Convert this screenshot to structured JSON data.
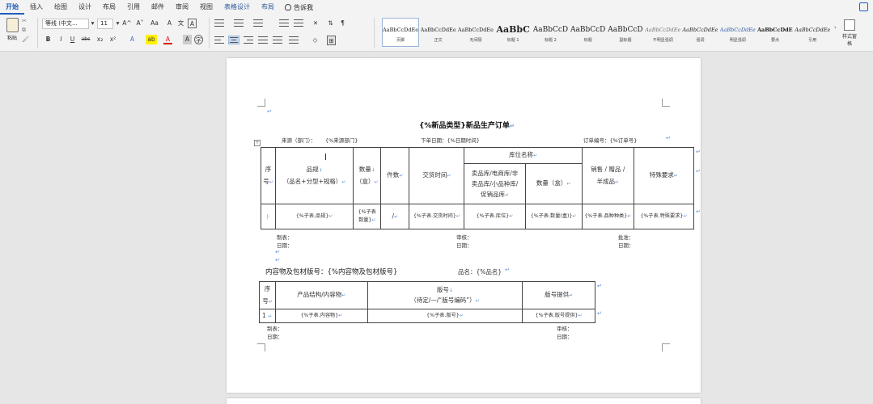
{
  "tabs": [
    "开始",
    "插入",
    "绘图",
    "设计",
    "布局",
    "引用",
    "邮件",
    "审阅",
    "视图",
    "表格设计",
    "布局"
  ],
  "tell_me": "告诉我",
  "ribbon": {
    "paste": "粘贴",
    "font_name": "等线 (中文...",
    "font_size": "11",
    "grow": "A^",
    "shrink": "A˅",
    "case": "Aa",
    "clear": "A",
    "wen": "文",
    "box": "A",
    "bold": "B",
    "italic": "I",
    "underline": "U",
    "strike": "abc",
    "sub": "x₂",
    "sup": "x²",
    "effect": "A",
    "highlight": "ab",
    "color": "A",
    "shade": "A",
    "circle": "字"
  },
  "styles": [
    {
      "sample": "AaBbCcDdEe",
      "name": "页脚",
      "selected": true
    },
    {
      "sample": "AaBbCcDdEe",
      "name": "正文"
    },
    {
      "sample": "AaBbCcDdEe",
      "name": "无间隔"
    },
    {
      "sample": "AaBbC",
      "name": "标题 1",
      "big": true
    },
    {
      "sample": "AaBbCcD",
      "name": "标题 2"
    },
    {
      "sample": "AaBbCcD",
      "name": "标题"
    },
    {
      "sample": "AaBbCcD",
      "name": "副标题"
    },
    {
      "sample": "AaBbCcDdEe",
      "name": "不明显强调"
    },
    {
      "sample": "AaBbCcDdEe",
      "name": "强调"
    },
    {
      "sample": "AaBbCcDdEe",
      "name": "明显强调"
    },
    {
      "sample": "AaBbCcDdEe",
      "name": "要点"
    },
    {
      "sample": "AaBbCcDdEe",
      "name": "引用"
    }
  ],
  "styles_pane": "样式窗格",
  "document": {
    "title": "{%新品类型}新品生产订单",
    "source_label": "来源（部门）：",
    "source_value": "{%来源部门}",
    "date_label": "下单日期：{%日期时间}",
    "order_label": "订单编号：{%订单号}",
    "table1": {
      "h_seq": [
        "序",
        "号"
      ],
      "h_product": [
        "品规",
        "（品名+分型+规格）"
      ],
      "h_qty": [
        "数量",
        "（盒）"
      ],
      "h_pieces": "件数",
      "h_delivery": "交货时间",
      "h_location": "库位名称",
      "h_loc_sub": [
        "卖品库/电商库/非",
        "卖品库/小品种库/",
        "促销品库"
      ],
      "h_loc_qty": "数量（盒）",
      "h_sales": [
        "销售 / 赠品 /",
        "半成品"
      ],
      "h_special": "特殊要求",
      "row": {
        "seq": "",
        "product": "{%子表.品规}",
        "qty": [
          "{%子表",
          "数量}"
        ],
        "pieces": "/",
        "delivery": "{%子表.交货时间}",
        "location": "{%子表.库位}",
        "loc_qty": "{%子表.数量(盒)}",
        "sales": "{%子表.品种种类}",
        "special": "{%子表.特殊要求}"
      }
    },
    "sign1": {
      "make": "制表：",
      "date": "日期：",
      "review": "审核：",
      "review_date": "日期：",
      "approve": "批准：",
      "approve_date": "日期："
    },
    "section2_title": "内容物及包材版号：{%内容物及包材版号}",
    "section2_name": "品名：{%品名}",
    "table2": {
      "h_seq": [
        "序",
        "号"
      ],
      "h_struct": "产品结构/内容物",
      "h_version": [
        "版号",
        "（待定/—/“版号编码”）"
      ],
      "h_provider": "版号提供",
      "row": {
        "seq": "1",
        "struct": "{%子表.内容物}",
        "version": "{%子表.版号}",
        "provider": "{%子表.版号提供}"
      }
    },
    "sign2": {
      "make": "制表：",
      "date": "日期：",
      "review": "审核：",
      "review_date": "日期："
    }
  }
}
